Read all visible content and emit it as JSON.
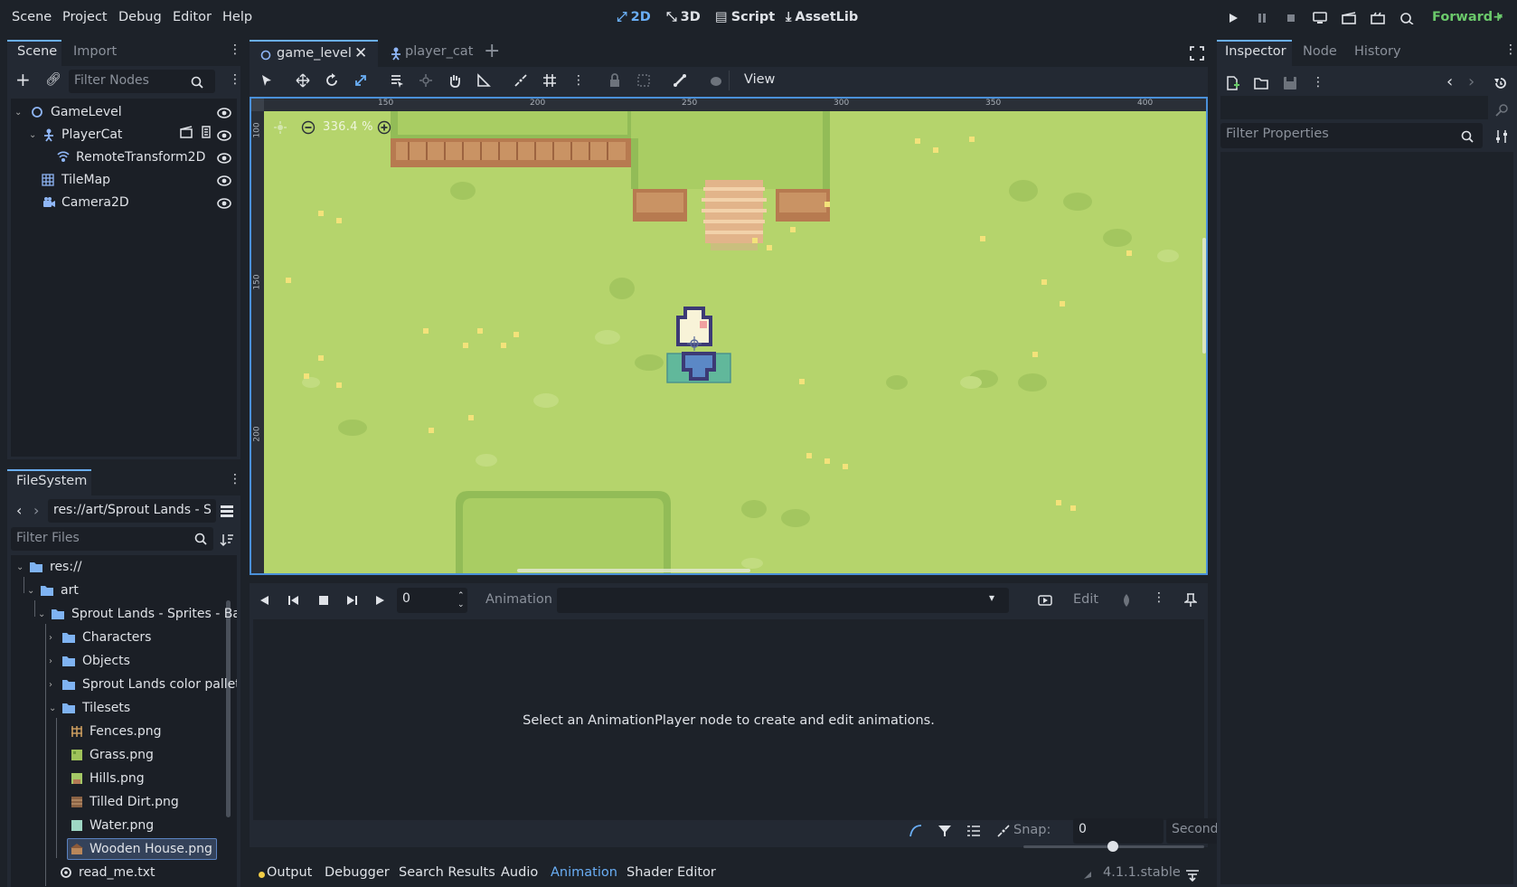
{
  "menubar": {
    "items": [
      "Scene",
      "Project",
      "Debug",
      "Editor",
      "Help"
    ]
  },
  "workspaces": {
    "d2": "2D",
    "d3": "3D",
    "script": "Script",
    "assetlib": "AssetLib"
  },
  "renderer": "Forward+",
  "scene_dock": {
    "tab_scene": "Scene",
    "tab_import": "Import",
    "filter_placeholder": "Filter Nodes",
    "nodes": [
      {
        "label": "GameLevel",
        "icon": "node2d-icon"
      },
      {
        "label": "PlayerCat",
        "icon": "character-body-icon"
      },
      {
        "label": "RemoteTransform2D",
        "icon": "remote-transform-icon"
      },
      {
        "label": "TileMap",
        "icon": "tilemap-icon"
      },
      {
        "label": "Camera2D",
        "icon": "camera-icon"
      }
    ]
  },
  "filesystem": {
    "tab": "FileSystem",
    "path": "res://art/Sprout Lands - S",
    "filter_placeholder": "Filter Files",
    "items": [
      {
        "label": "res://",
        "type": "folder"
      },
      {
        "label": "art",
        "type": "folder"
      },
      {
        "label": "Sprout Lands - Sprites - Basic",
        "type": "folder"
      },
      {
        "label": "Characters",
        "type": "folder"
      },
      {
        "label": "Objects",
        "type": "folder"
      },
      {
        "label": "Sprout Lands color pallet",
        "type": "folder"
      },
      {
        "label": "Tilesets",
        "type": "folder"
      },
      {
        "label": "Fences.png",
        "type": "image"
      },
      {
        "label": "Grass.png",
        "type": "image"
      },
      {
        "label": "Hills.png",
        "type": "image"
      },
      {
        "label": "Tilled Dirt.png",
        "type": "image"
      },
      {
        "label": "Water.png",
        "type": "image"
      },
      {
        "label": "Wooden House.png",
        "type": "image"
      },
      {
        "label": "read_me.txt",
        "type": "text"
      }
    ]
  },
  "editor_tabs": [
    {
      "label": "game_level",
      "active": true
    },
    {
      "label": "player_cat",
      "active": false
    }
  ],
  "viewport": {
    "view_menu": "View",
    "zoom": "336.4 %",
    "ruler_ticks": [
      "150",
      "200",
      "250",
      "300",
      "350",
      "400"
    ],
    "vruler_ticks": [
      "100",
      "150",
      "200"
    ]
  },
  "animation": {
    "frame_value": "0",
    "label": "Animation",
    "edit": "Edit",
    "empty_message": "Select an AnimationPlayer node to create and edit animations.",
    "snap_label": "Snap:",
    "snap_value": "0",
    "snap_unit": "Seconds"
  },
  "bottom_tabs": [
    "Output",
    "Debugger",
    "Search Results",
    "Audio",
    "Animation",
    "Shader Editor"
  ],
  "version": "4.1.1.stable",
  "inspector": {
    "tabs": [
      "Inspector",
      "Node",
      "History"
    ],
    "filter_placeholder": "Filter Properties"
  },
  "colors": {
    "accent": "#6aaef5",
    "renderer": "#6bc96b",
    "grass": "#b5d46c",
    "panel": "#232933",
    "background": "#1d2229"
  }
}
